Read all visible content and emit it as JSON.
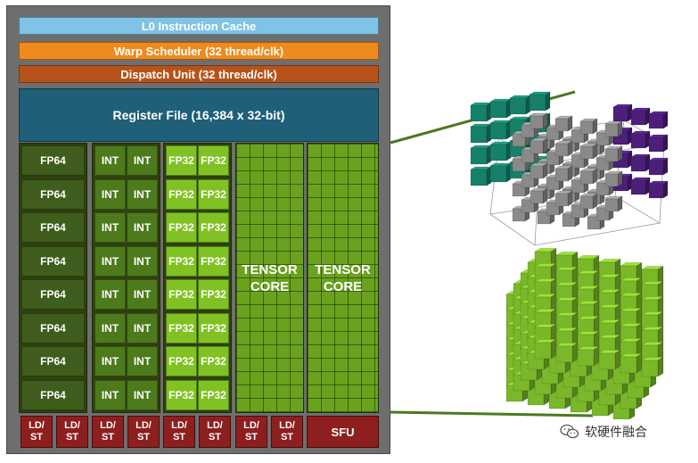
{
  "sm": {
    "l0_cache": "L0 Instruction Cache",
    "warp_scheduler": "Warp Scheduler (32 thread/clk)",
    "dispatch_unit": "Dispatch Unit (32 thread/clk)",
    "register_file": "Register File (16,384 x 32-bit)",
    "fp64_label": "FP64",
    "int_label": "INT",
    "fp32_label": "FP32",
    "tensor_core": [
      "TENSOR",
      "CORE"
    ],
    "ldst_label": [
      "LD/",
      "ST"
    ],
    "sfu_label": "SFU",
    "rows": 8
  },
  "colors": {
    "l0": "#7fc3e6",
    "warp": "#f08a1c",
    "dispatch": "#b7531a",
    "register_file": "#1f5f78",
    "fp64": "#3f5d1c",
    "int": "#4d7a1b",
    "fp32": "#80c224",
    "tensor": "#6aa21e",
    "ldst": "#8e1f1f",
    "matrix_a": "#16806a",
    "matrix_b": "#4b1f7a",
    "matrix_c": "#8a8a8a",
    "result_stack": "#7ab82a"
  },
  "watermark": {
    "icon": "wechat-icon",
    "text": "软硬件融合"
  }
}
